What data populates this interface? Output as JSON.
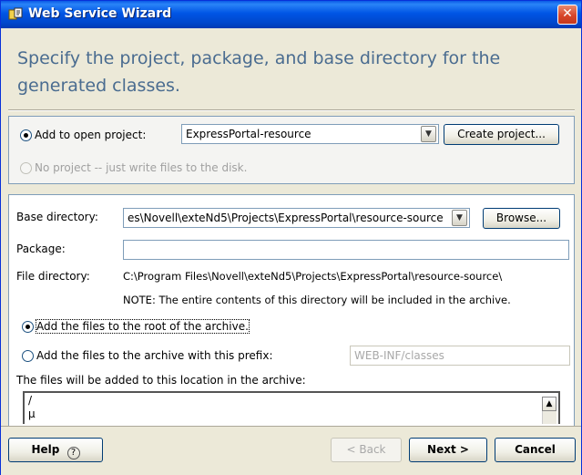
{
  "window": {
    "title": "Web Service Wizard",
    "close_glyph": "✕",
    "headline_line1": "Specify the project, package, and base directory for the",
    "headline_line2": "generated classes."
  },
  "project_section": {
    "add_to_open_project_label": "Add to open project:",
    "open_project_value": "ExpressPortal-resource",
    "create_project_button": "Create project...",
    "no_project_label": "No project -- just write files to the disk."
  },
  "settings_section": {
    "base_directory_label": "Base directory:",
    "base_directory_value": "es\\Novell\\exteNd5\\Projects\\ExpressPortal\\resource-source",
    "browse_button": "Browse...",
    "package_label": "Package:",
    "package_value": "",
    "file_directory_label": "File directory:",
    "file_directory_value": "C:\\Program Files\\Novell\\exteNd5\\Projects\\ExpressPortal\\resource-source\\",
    "note_text": "NOTE: The entire contents of this directory will be included in the archive.",
    "root_option_label": "Add the files to the root of the archive.",
    "prefix_option_label": "Add the files to the archive with this prefix:",
    "prefix_value": "WEB-INF/classes",
    "location_label": "The files will be added to this location in the archive:",
    "location_line1": "/",
    "location_line2": "µ"
  },
  "footer": {
    "help_button": "Help",
    "help_glyph": "?",
    "back_button": "< Back",
    "next_button": "Next >",
    "cancel_button": "Cancel"
  },
  "icons": {
    "app_icon": "wizard-app-icon",
    "dropdown_arrow": "chevron-down-icon",
    "scroll_up": "scroll-up-arrow-icon",
    "help": "help-circle-icon"
  },
  "colors": {
    "title_bar": "#0055e5",
    "headline_text": "#4a6c90",
    "dialog_background": "#ece9d8",
    "radio_selected": "#21a121"
  }
}
